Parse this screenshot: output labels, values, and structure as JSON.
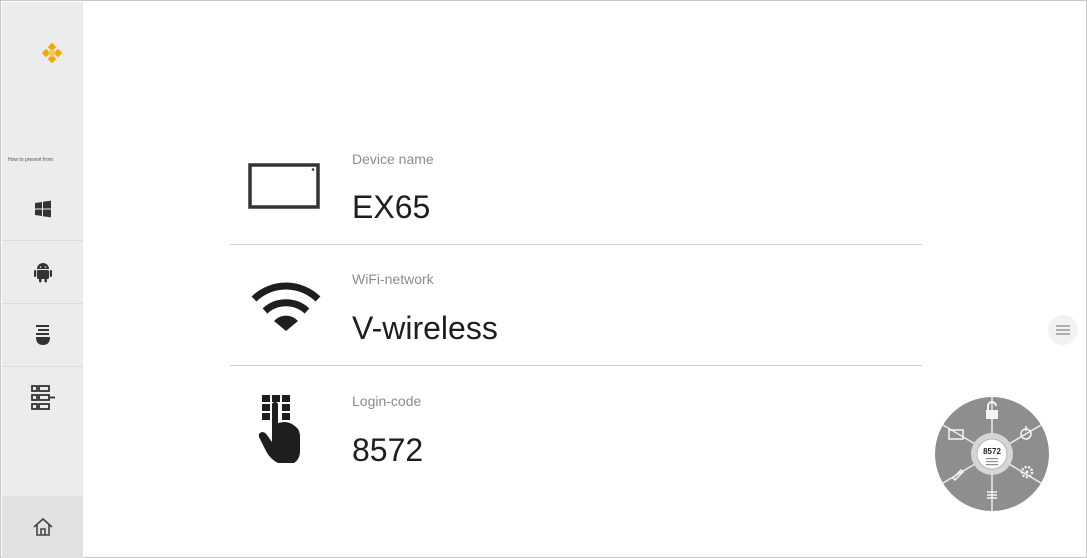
{
  "sidebar": {
    "caption": "How to present from",
    "items": [
      {
        "name": "windows",
        "icon": "windows-icon"
      },
      {
        "name": "android",
        "icon": "android-icon"
      },
      {
        "name": "apple",
        "icon": "apple-icon"
      },
      {
        "name": "more",
        "icon": "list-grid-icon"
      }
    ],
    "home_icon": "home-icon"
  },
  "info": {
    "device": {
      "label": "Device name",
      "value": "EX65",
      "icon": "display-icon"
    },
    "wifi": {
      "label": "WiFi-network",
      "value": "V-wireless",
      "icon": "wifi-icon"
    },
    "login": {
      "label": "Login-code",
      "value": "8572",
      "icon": "keypad-hand-icon"
    }
  },
  "control_wheel": {
    "code": "8572",
    "segments": [
      "lock-icon",
      "share-icon",
      "settings-icon",
      "list-icon",
      "pen-icon",
      "screen-icon"
    ]
  },
  "menu_button": {
    "icon": "hamburger-icon"
  },
  "colors": {
    "accent": "#f2a900",
    "text": "#1e1e1e",
    "label": "#8c8c8c",
    "sidebar": "#ececec",
    "wheel": "#8e8e8e"
  }
}
